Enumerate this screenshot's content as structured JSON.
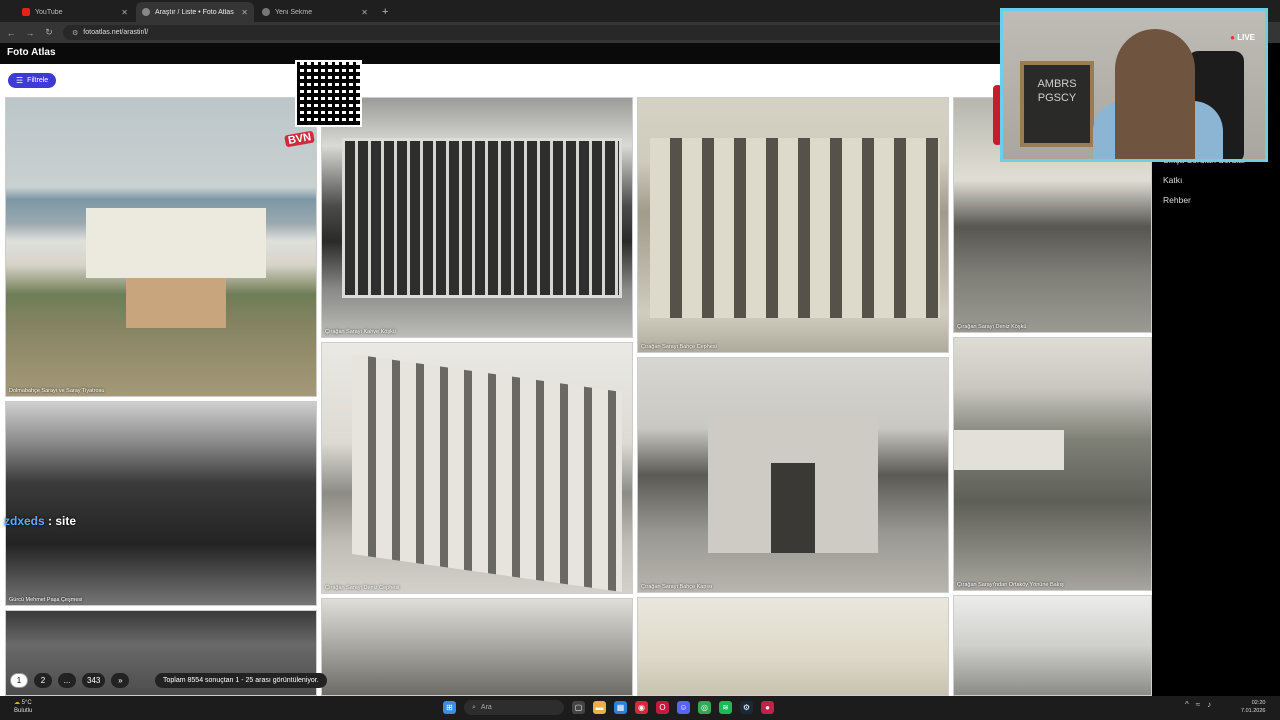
{
  "browser": {
    "tabs": [
      {
        "label": "YouTube",
        "active": false
      },
      {
        "label": "Araştır / Liste • Foto Atlas",
        "active": true
      },
      {
        "label": "Yeni Sekme",
        "active": false
      }
    ],
    "url": "fotoatlas.net/arastir/l/"
  },
  "site": {
    "logo": "Foto Atlas",
    "filter_label": "Filtrele"
  },
  "photos": [
    {
      "caption": "Dolmabahçe Sarayı ve Saray Tiyatrosu"
    },
    {
      "caption": "Çırağan Sarayı Kahve Köşkü"
    },
    {
      "caption": "Çırağan Sarayı Bahçe Cephesi"
    },
    {
      "caption": "Çırağan Sarayı Deniz Köşkü"
    },
    {
      "caption": "Gürcü Mehmet Paşa Çeşmesi"
    },
    {
      "caption": "Çırağan Sarayı Deniz Cephesi"
    },
    {
      "caption": "Çırağan Sarayı Bahçe Kapısı"
    },
    {
      "caption": "Çırağan Sarayı'ndan Ortaköy Yönüne Bakış"
    }
  ],
  "pagination": {
    "pages": [
      "1",
      "2",
      "...",
      "343",
      "»"
    ],
    "info": "Toplam 8554 sonuçtan 1 - 25 arası görüntüleniyor."
  },
  "side_menu": [
    "Sıkça Sorulan Sorular",
    "Katkı",
    "Rehber"
  ],
  "stream": {
    "live_label": "LIVE",
    "board_text": "AMBRS PGSCY",
    "watermark_a": "zdxeds",
    "watermark_b": " : site",
    "badge": "BVN"
  },
  "taskbar": {
    "weather_temp": "5°C",
    "weather_desc": "Bulutlu",
    "search_placeholder": "Ara",
    "time": "02:20",
    "date": "7.01.2026"
  },
  "colors": {
    "accent": "#3d3ad6",
    "cam_border": "#6ad0e8"
  }
}
